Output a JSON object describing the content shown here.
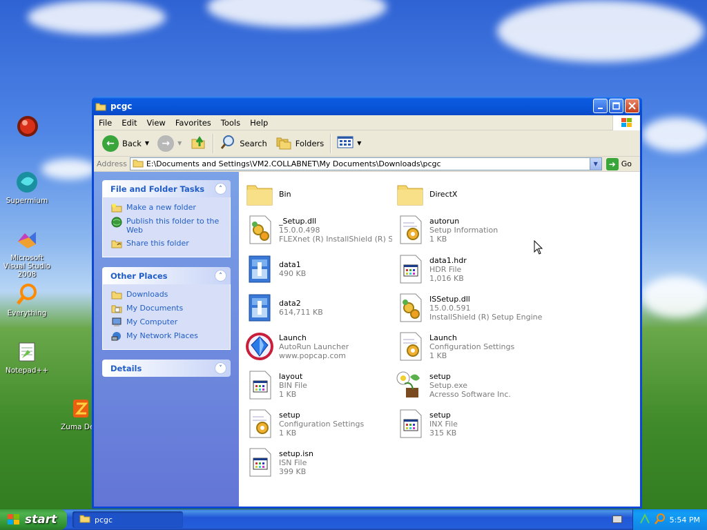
{
  "desktop": {
    "icons": [
      {
        "label": "",
        "icon": "red-orb-icon"
      },
      {
        "label": "Supermium",
        "icon": "supermium-icon"
      },
      {
        "label": "Microsoft Visual Studio 2008",
        "icon": "visual-studio-icon"
      },
      {
        "label": "Everything",
        "icon": "everything-search-icon"
      },
      {
        "label": "Notepad++",
        "icon": "notepad-plus-plus-icon"
      },
      {
        "label": "Zuma Delu",
        "icon": "zuma-icon"
      }
    ]
  },
  "window": {
    "title": "pcgc",
    "menu": [
      "File",
      "Edit",
      "View",
      "Favorites",
      "Tools",
      "Help"
    ],
    "toolbar": {
      "back": "Back",
      "search": "Search",
      "folders": "Folders"
    },
    "address": {
      "label": "Address",
      "value": "E:\\Documents and Settings\\VM2.COLLABNET\\My Documents\\Downloads\\pcgc",
      "go": "Go"
    },
    "tasks": {
      "file_folder": {
        "title": "File and Folder Tasks",
        "items": [
          "Make a new folder",
          "Publish this folder to the Web",
          "Share this folder"
        ]
      },
      "other_places": {
        "title": "Other Places",
        "items": [
          "Downloads",
          "My Documents",
          "My Computer",
          "My Network Places"
        ]
      },
      "details": {
        "title": "Details"
      }
    },
    "files": [
      {
        "name": "Bin",
        "line2": "",
        "line3": "",
        "icon": "folder-icon"
      },
      {
        "name": "DirectX",
        "line2": "",
        "line3": "",
        "icon": "folder-icon"
      },
      {
        "name": "_Setup.dll",
        "line2": "15.0.0.498",
        "line3": "FLEXnet (R) InstallShield (R) S...",
        "icon": "dll-gear-icon"
      },
      {
        "name": "autorun",
        "line2": "Setup Information",
        "line3": "1 KB",
        "icon": "config-gear-icon"
      },
      {
        "name": "data1",
        "line2": "490 KB",
        "line3": "",
        "icon": "cab-archive-icon"
      },
      {
        "name": "data1.hdr",
        "line2": "HDR File",
        "line3": "1,016 KB",
        "icon": "generic-file-icon"
      },
      {
        "name": "data2",
        "line2": "614,711 KB",
        "line3": "",
        "icon": "cab-archive-icon"
      },
      {
        "name": "ISSetup.dll",
        "line2": "15.0.0.591",
        "line3": "InstallShield (R) Setup Engine",
        "icon": "dll-gear-icon"
      },
      {
        "name": "Launch",
        "line2": "AutoRun Launcher",
        "line3": "www.popcap.com",
        "icon": "popcap-launcher-icon"
      },
      {
        "name": "Launch",
        "line2": "Configuration Settings",
        "line3": "1 KB",
        "icon": "config-gear-icon"
      },
      {
        "name": "layout",
        "line2": "BIN File",
        "line3": "1 KB",
        "icon": "generic-file-icon"
      },
      {
        "name": "setup",
        "line2": "Setup.exe",
        "line3": "Acresso Software Inc.",
        "icon": "setup-exe-icon"
      },
      {
        "name": "setup",
        "line2": "Configuration Settings",
        "line3": "1 KB",
        "icon": "config-gear-icon"
      },
      {
        "name": "setup",
        "line2": "INX File",
        "line3": "315 KB",
        "icon": "generic-file-icon"
      },
      {
        "name": "setup.isn",
        "line2": "ISN File",
        "line3": "399 KB",
        "icon": "generic-file-icon"
      }
    ]
  },
  "taskbar": {
    "start": "start",
    "task": "pcgc",
    "clock": "5:54 PM"
  }
}
